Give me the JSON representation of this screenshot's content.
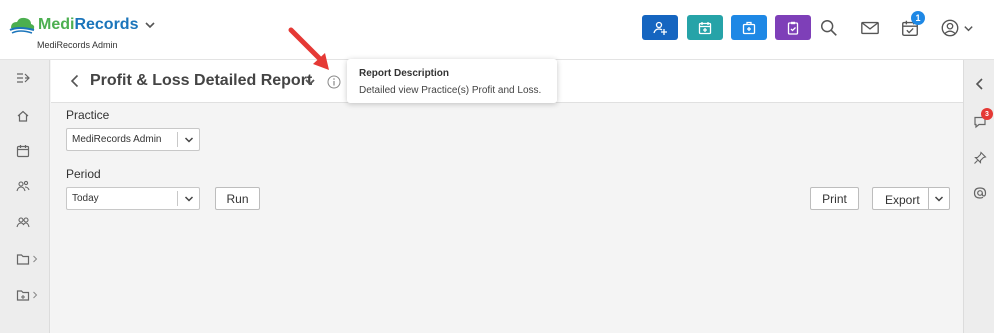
{
  "brand": {
    "name_part1": "Medi",
    "name_part2": "Records",
    "subtitle": "MediRecords Admin"
  },
  "header": {
    "quick_actions": [
      "add-patient",
      "appointment",
      "add-medical",
      "clipboard"
    ],
    "notification_count": "1"
  },
  "page": {
    "title": "Profit & Loss Detailed Report"
  },
  "form": {
    "practice_label": "Practice",
    "practice_value": "MediRecords Admin",
    "period_label": "Period",
    "period_value": "Today",
    "run_label": "Run",
    "print_label": "Print",
    "export_label": "Export"
  },
  "tooltip": {
    "title": "Report Description",
    "body": "Detailed view Practice(s) Profit and Loss."
  },
  "right_sidebar": {
    "comments_badge": "3"
  },
  "colors": {
    "brand_green": "#4caf50",
    "brand_blue": "#1b75bb",
    "btn_blue_dark": "#1565c0",
    "btn_teal": "#26a3a8",
    "btn_blue": "#1e88e5",
    "btn_purple": "#7e3fb8",
    "badge_red": "#e53935",
    "annotation_red": "#e53935"
  }
}
